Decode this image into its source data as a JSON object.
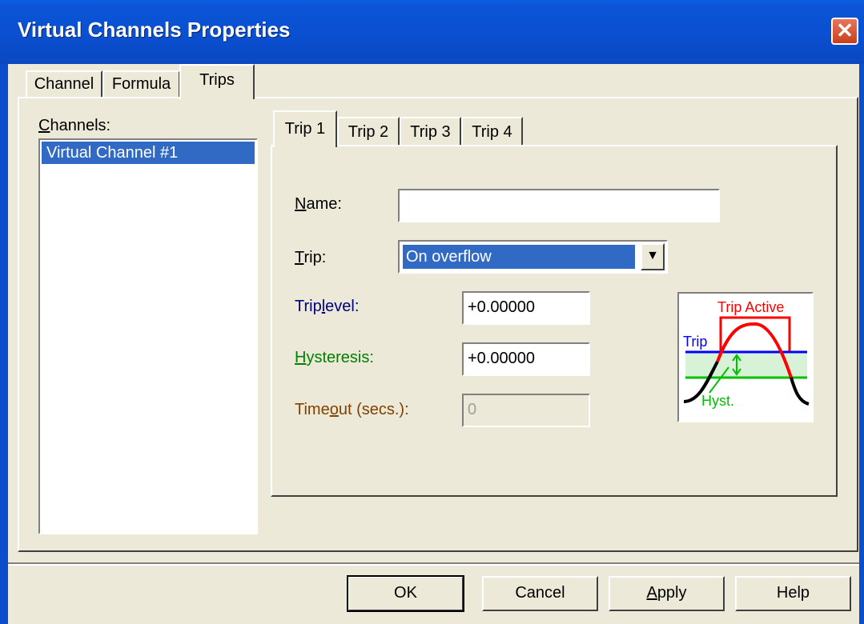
{
  "window": {
    "title": "Virtual Channels Properties",
    "close_glyph": "✕"
  },
  "tabs": [
    {
      "label": "Channel"
    },
    {
      "label": "Formula"
    },
    {
      "label": "Trips"
    }
  ],
  "channels": {
    "label_mnemonic": "C",
    "label_rest": "hannels:",
    "items": [
      "Virtual Channel #1"
    ]
  },
  "trip_tabs": [
    {
      "label": "Trip 1"
    },
    {
      "label": "Trip 2"
    },
    {
      "label": "Trip 3"
    },
    {
      "label": "Trip 4"
    }
  ],
  "form": {
    "name_label_mnemonic": "N",
    "name_label_rest": "ame:",
    "name_value": "",
    "trip_label_mnemonic": "T",
    "trip_label_rest": "rip:",
    "trip_selected": "On overflow",
    "triplevel_label_pre": "Trip",
    "triplevel_label_mnemonic": "l",
    "triplevel_label_rest": "evel:",
    "triplevel_value": "+0.00000",
    "hysteresis_label_mnemonic": "H",
    "hysteresis_label_rest": "ysteresis:",
    "hysteresis_value": "+0.00000",
    "timeout_label_pre": "Time",
    "timeout_label_mnemonic": "o",
    "timeout_label_rest": "ut (secs.):",
    "timeout_value": "0"
  },
  "diagram": {
    "active_label": "Trip Active",
    "trip_label": "Trip",
    "hyst_label": "Hyst."
  },
  "buttons": {
    "ok": "OK",
    "cancel": "Cancel",
    "apply_mnemonic": "A",
    "apply_rest": "pply",
    "help": "Help"
  },
  "colors": {
    "triplevel": "#000080",
    "hysteresis": "#008000",
    "timeout": "#804000",
    "selection": "#316ac5"
  }
}
